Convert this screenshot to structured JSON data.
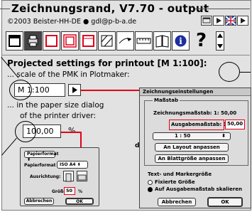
{
  "window": {
    "title": "Zeichnungsrand, V7.70 - output",
    "copyright": "©2003 Beister-HH-DE ● gdl@p-b-a.de"
  },
  "toolbar": {
    "help_label": "?",
    "info_label": "i"
  },
  "projected": {
    "heading": "Projected settings for printout [M 1:100]:",
    "line1": "... scale of the PMK in Plotmaker:",
    "scale_value": "M 1:100",
    "line2": "... in the paper size dialog",
    "line3": "of the printer driver:",
    "percent_value": "100,00",
    "percent_unit": "%"
  },
  "paper_dialog": {
    "format_label": "Papierformat",
    "format_select": "ISO A4",
    "orientation_label": "Ausrichtung:",
    "size_label": "Größe:",
    "size_value": "50",
    "size_unit": "%",
    "cancel": "Abbrechen",
    "ok": "OK"
  },
  "settings_dialog": {
    "title": "Zeichnungseinstellungen",
    "group_scale": "Maßstab",
    "drawing_scale_label": "Zeichnungsmaßstab: 1:",
    "drawing_scale_value": "50,00",
    "output_scale_label": "Ausgabemaßstab: 1:",
    "output_scale_value": "50,00",
    "select_value": "1 : 50",
    "fit_layout": "An Layout anpassen",
    "fit_sheet": "An Blattgröße anpassen",
    "group_text": "Text- und Markergröße",
    "radio_fixed": "Fixierte Größe",
    "radio_scale": "Auf Ausgabemaßstab skalieren",
    "cancel": "Abbrechen",
    "ok": "OK",
    "edge_char": "d"
  }
}
